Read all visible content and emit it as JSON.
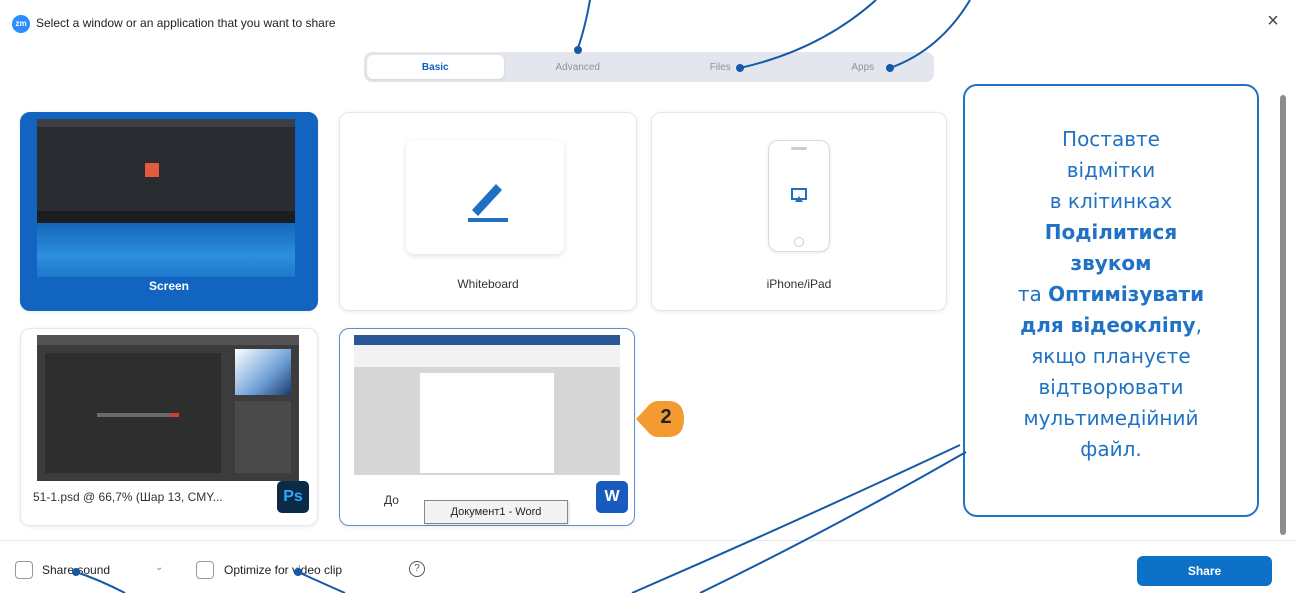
{
  "window": {
    "app_icon": "zoom-logo",
    "title": "Select a window or an application that you want to share",
    "close_label": "×"
  },
  "tabs": [
    {
      "label": "Basic",
      "active": true
    },
    {
      "label": "Advanced",
      "active": false
    },
    {
      "label": "Files",
      "active": false
    },
    {
      "label": "Apps",
      "active": false
    }
  ],
  "tiles": {
    "screen": "Screen",
    "whiteboard": "Whiteboard",
    "iphone": "iPhone/iPad",
    "photoshop": "51-1.psd @ 66,7% (Шар 13, CMY...",
    "photoshop_badge": "Ps",
    "word": "Документ1 - Word",
    "word_badge": "W"
  },
  "tooltip": "Документ1 - Word",
  "badge_number": "2",
  "bottom": {
    "share_sound": "Share sound",
    "optimize": "Optimize for video clip",
    "help": "?",
    "share_button": "Share"
  },
  "callout": {
    "line1": "Поставте",
    "line2": "відмітки",
    "line3": "в клітинках",
    "bold1": "Поділитися",
    "bold2": "звуком",
    "prefix": "та ",
    "bold3": "Оптимізувати",
    "bold4": "для відеокліпу",
    "comma": ",",
    "line5": "якщо плануєте",
    "line6": "відтворювати",
    "line7": "мультимедійний",
    "line8": "файл."
  },
  "colors": {
    "accent": "#1f72c4",
    "share_button": "#0e71c8",
    "screen_tile": "#1164c0",
    "badge": "#f39b31"
  }
}
